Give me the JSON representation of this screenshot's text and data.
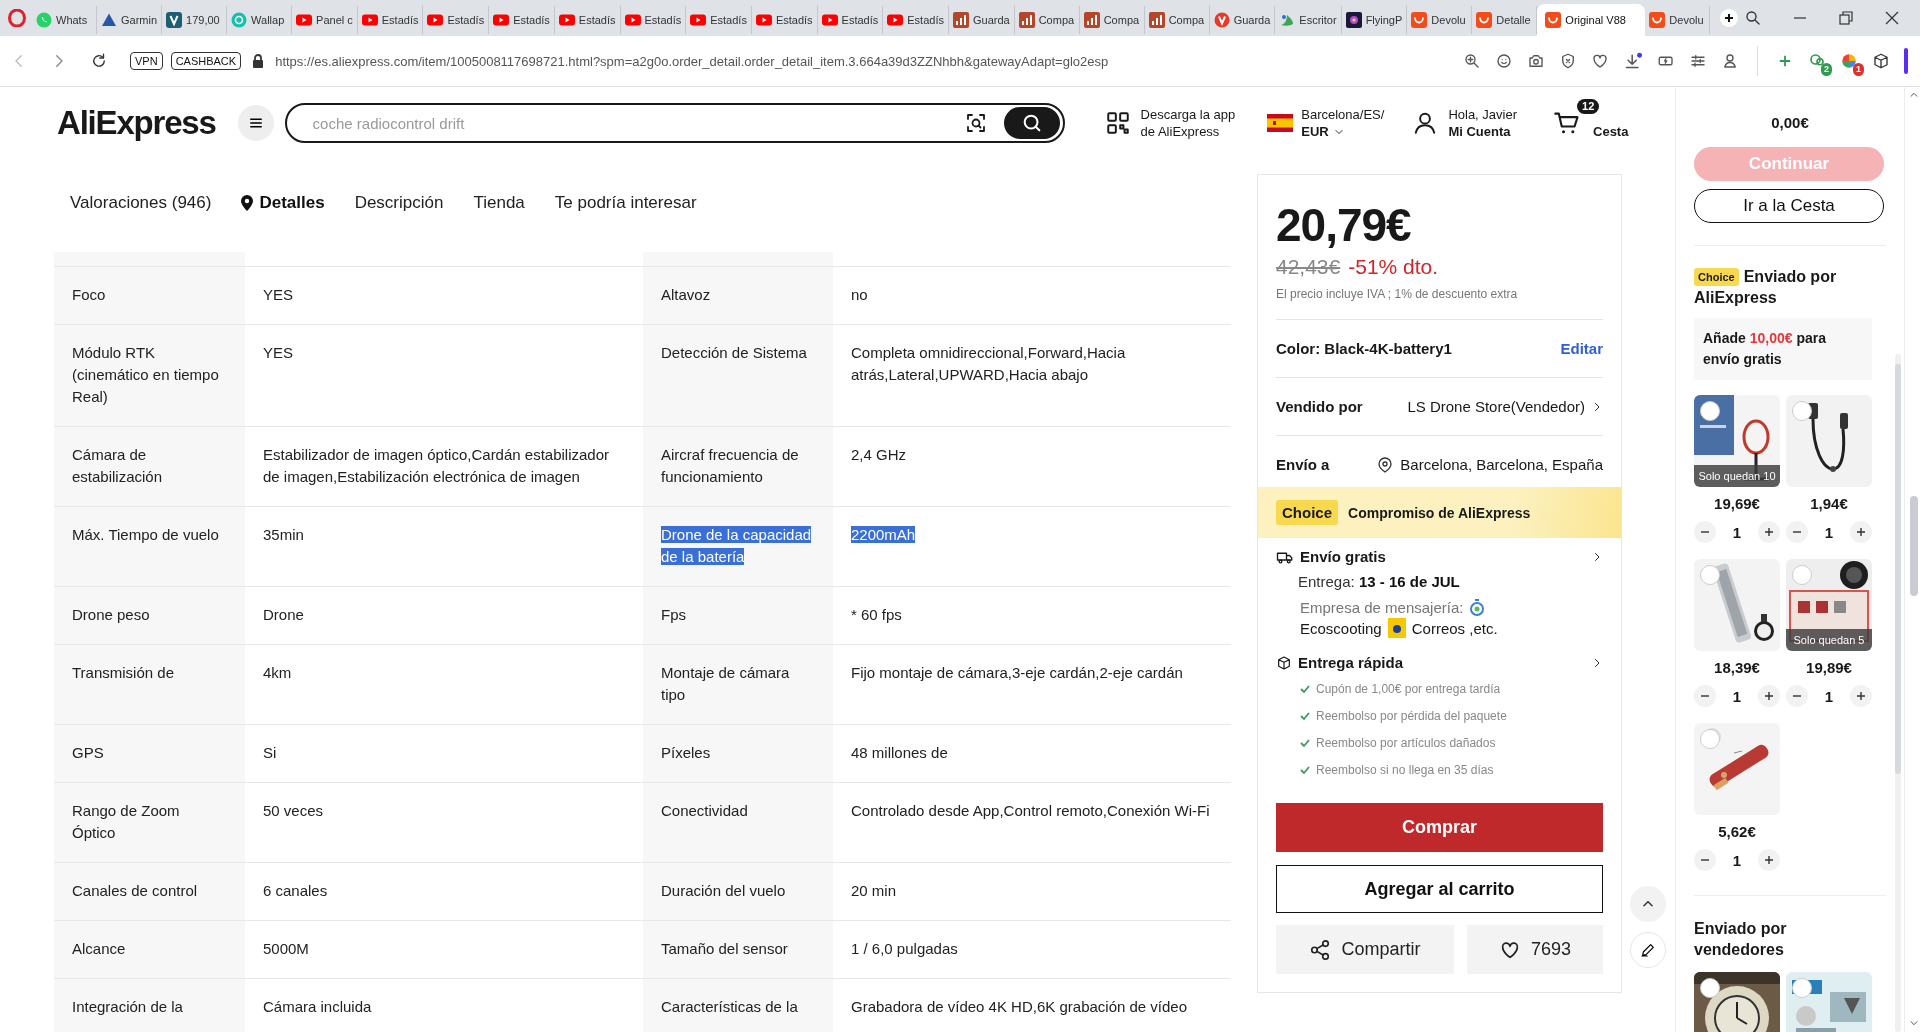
{
  "browser": {
    "tabs": [
      {
        "title": "Whats",
        "kind": "whatsapp",
        "selected": false
      },
      {
        "title": "Garmin",
        "kind": "garmin",
        "selected": false
      },
      {
        "title": "179,00",
        "kind": "vbox",
        "selected": false
      },
      {
        "title": "Wallap",
        "kind": "wallapop",
        "selected": false
      },
      {
        "title": "Panel c",
        "kind": "youtube",
        "selected": false
      },
      {
        "title": "Estadís",
        "kind": "youtube",
        "selected": false
      },
      {
        "title": "Estadís",
        "kind": "youtube",
        "selected": false
      },
      {
        "title": "Estadís",
        "kind": "youtube",
        "selected": false
      },
      {
        "title": "Estadís",
        "kind": "youtube",
        "selected": false
      },
      {
        "title": "Estadís",
        "kind": "youtube",
        "selected": false
      },
      {
        "title": "Estadís",
        "kind": "youtube",
        "selected": false
      },
      {
        "title": "Estadís",
        "kind": "youtube",
        "selected": false
      },
      {
        "title": "Estadís",
        "kind": "youtube",
        "selected": false
      },
      {
        "title": "Estadís",
        "kind": "youtube",
        "selected": false
      },
      {
        "title": "Guarda",
        "kind": "chart",
        "selected": false
      },
      {
        "title": "Compa",
        "kind": "chart",
        "selected": false
      },
      {
        "title": "Compa",
        "kind": "chart",
        "selected": false
      },
      {
        "title": "Compa",
        "kind": "chart",
        "selected": false
      },
      {
        "title": "Guarda",
        "kind": "vivaldi",
        "selected": false
      },
      {
        "title": "Escritor",
        "kind": "desk",
        "selected": false
      },
      {
        "title": "FlyingP",
        "kind": "flying",
        "selected": false
      },
      {
        "title": "Devolu",
        "kind": "aliexpress",
        "selected": false
      },
      {
        "title": "Detalle",
        "kind": "aliexpress",
        "selected": false
      },
      {
        "title": "Original V88",
        "kind": "aliexpress",
        "selected": true
      },
      {
        "title": "Devolu",
        "kind": "aliexpress",
        "selected": false
      }
    ],
    "badges": [
      "VPN",
      "CASHBACK"
    ],
    "url": "https://es.aliexpress.com/item/1005008117698721.html?spm=a2g0o.order_detail.order_detail_item.3.664a39d3ZZNhbh&gatewayAdapt=glo2esp",
    "extensions": [
      {
        "kind": "add"
      },
      {
        "kind": "cloud",
        "badge": "2"
      },
      {
        "kind": "color",
        "badge": "1"
      },
      {
        "kind": "cube"
      }
    ]
  },
  "header": {
    "logo": "AliExpress",
    "search": {
      "placeholder": "coche radiocontrol drift"
    },
    "app": [
      "Descarga la app",
      "de AliExpress"
    ],
    "region": {
      "location": "Barcelona/ES/",
      "currency": "EUR"
    },
    "account": {
      "greeting": "Hola, Javier",
      "label": "Mi Cuenta"
    },
    "cart": {
      "count": "12",
      "label": "Cesta"
    }
  },
  "nav": [
    {
      "label": "Valoraciones (946)",
      "selected": false
    },
    {
      "label": "Detalles",
      "selected": true
    },
    {
      "label": "Descripción",
      "selected": false
    },
    {
      "label": "Tienda",
      "selected": false
    },
    {
      "label": "Te podría interesar",
      "selected": false
    }
  ],
  "specs": [
    {
      "label_1": "Foco",
      "value_1": "YES",
      "label_2": "Altavoz",
      "value_2": "no",
      "text_selected": false
    },
    {
      "label_1": "Módulo RTK (cinemático en tiempo Real)",
      "value_1": "YES",
      "label_2": "Detección de Sistema",
      "value_2": "Completa omnidireccional,Forward,Hacia atrás,Lateral,UPWARD,Hacia abajo",
      "text_selected": false
    },
    {
      "label_1": "Cámara de estabilización",
      "value_1": "Estabilizador de imagen óptico,Cardán estabilizador de imagen,Estabilización electrónica de imagen",
      "label_2": "Aircraf frecuencia de funcionamiento",
      "value_2": "2,4 GHz",
      "text_selected": false
    },
    {
      "label_1": "Máx. Tiempo de vuelo",
      "value_1": "35min",
      "label_2": "Drone de la capacidad de la batería",
      "value_2": "2200mAh",
      "text_selected": true
    },
    {
      "label_1": "Drone peso",
      "value_1": "Drone",
      "label_2": "Fps",
      "value_2": "* 60 fps",
      "text_selected": false
    },
    {
      "label_1": "Transmisión de",
      "value_1": "4km",
      "label_2": "Montaje de cámara tipo",
      "value_2": "Fijo montaje de cámara,3-eje cardán,2-eje cardán",
      "text_selected": false
    },
    {
      "label_1": "GPS",
      "value_1": "Si",
      "label_2": "Píxeles",
      "value_2": "48 millones de",
      "text_selected": false
    },
    {
      "label_1": "Rango de Zoom Óptico",
      "value_1": "50 veces",
      "label_2": "Conectividad",
      "value_2": "Controlado desde App,Control remoto,Conexión Wi-Fi",
      "text_selected": false
    },
    {
      "label_1": "Canales de control",
      "value_1": "6 canales",
      "label_2": "Duración del vuelo",
      "value_2": "20 min",
      "text_selected": false
    },
    {
      "label_1": "Alcance",
      "value_1": "5000M",
      "label_2": "Tamaño del sensor",
      "value_2": "1 / 6,0 pulgadas",
      "text_selected": false
    },
    {
      "label_1": "Integración de la",
      "value_1": "Cámara incluida",
      "label_2": "Características de la",
      "value_2": "Grabadora de vídeo 4K HD,6K grabación de vídeo",
      "text_selected": false
    }
  ],
  "buy": {
    "price": "20,79€",
    "original_price": "42,43€",
    "discount": "-51% dto.",
    "tax_note": "El precio incluye IVA ; 1% de descuento extra",
    "color_option": "Color: Black-4K-battery1",
    "edit_link": "Editar",
    "seller_label": "Vendido por",
    "seller": "LS Drone Store(Vendedor)",
    "ship_to_label": "Envío a",
    "ship_to": "Barcelona, Barcelona, España",
    "choice": {
      "badge": "Choice",
      "title": "Compromiso de AliExpress"
    },
    "free_shipping": {
      "title": "Envío gratis",
      "delivery": "Entrega: **13 - 16 de JUL**",
      "carrier_label": "Empresa de mensajería:",
      "carriers": [
        "Ecoscooting",
        "Correos ,etc."
      ]
    },
    "fast_delivery": {
      "title": "Entrega rápida",
      "guarantees": [
        "Cupón de 1,00€ por entrega tardía",
        "Reembolso por pérdida del paquete",
        "Reembolso por artículos dañados",
        "Reembolso si no llega en 35 días"
      ]
    },
    "buy_button": "Comprar",
    "add_to_cart_button": "Agregar al carrito",
    "share_button": "Compartir",
    "wishlist_count": "7693"
  },
  "cart_panel": {
    "total": "0,00€",
    "continue_button": {
      "label": "Continuar",
      "disabled": true
    },
    "cart_button": "Ir a la Cesta",
    "choice_group": {
      "badge": "Choice",
      "title_lines": [
        "Enviado por",
        "AliExpress"
      ],
      "free_shipping_note": "Añade **10,00€** para envío gratis",
      "products": [
        {
          "price": "19,69€",
          "quantity": "1",
          "stock_note": "Solo quedan 10",
          "checked": false
        },
        {
          "price": "1,94€",
          "quantity": "1",
          "checked": false
        },
        {
          "price": "18,39€",
          "quantity": "1",
          "checked": false
        },
        {
          "price": "19,89€",
          "quantity": "1",
          "stock_note": "Solo quedan 5",
          "checked": false
        },
        {
          "price": "5,62€",
          "quantity": "1",
          "checked": false
        }
      ]
    },
    "seller_group": {
      "title": "Enviado por vendedores",
      "products": [
        {
          "checked": false
        },
        {
          "checked": false
        }
      ]
    }
  }
}
